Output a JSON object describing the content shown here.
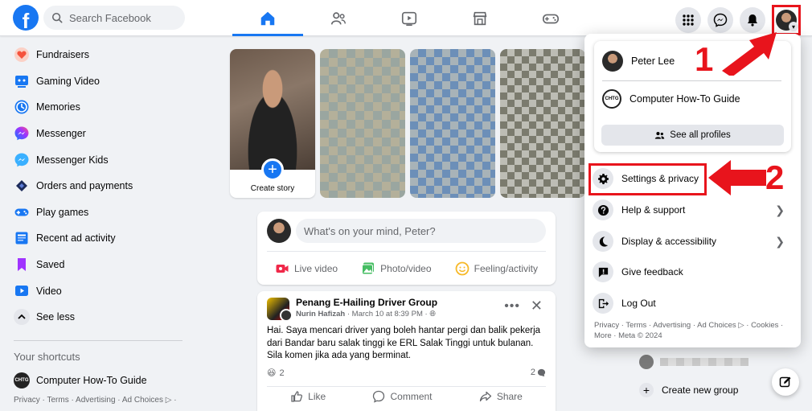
{
  "top_bar": {
    "logo": "f",
    "search_placeholder": "Search Facebook",
    "nav_tabs": [
      "home-icon",
      "friends-icon",
      "video-icon",
      "marketplace-icon",
      "gaming-icon"
    ],
    "right_icons": [
      "menu-grid-icon",
      "messenger-icon",
      "bell-icon",
      "account-avatar"
    ]
  },
  "sidebar": {
    "items": [
      {
        "label": "Fundraisers",
        "icon": "fundraiser-icon",
        "color": "#f5533d"
      },
      {
        "label": "Gaming Video",
        "icon": "gaming-video-icon",
        "color": "#1877f2"
      },
      {
        "label": "Memories",
        "icon": "memories-icon",
        "color": "#1877f2"
      },
      {
        "label": "Messenger",
        "icon": "messenger-icon",
        "color": "#a033ff"
      },
      {
        "label": "Messenger Kids",
        "icon": "messenger-kids-icon",
        "color": "#3ab0ff"
      },
      {
        "label": "Orders and payments",
        "icon": "orders-icon",
        "color": "#1c2b5a"
      },
      {
        "label": "Play games",
        "icon": "play-games-icon",
        "color": "#1877f2"
      },
      {
        "label": "Recent ad activity",
        "icon": "ad-activity-icon",
        "color": "#1877f2"
      },
      {
        "label": "Saved",
        "icon": "saved-icon",
        "color": "#a033ff"
      },
      {
        "label": "Video",
        "icon": "video-icon",
        "color": "#1877f2"
      },
      {
        "label": "See less",
        "icon": "chevron-up-icon",
        "color": "#e4e6eb"
      }
    ],
    "shortcuts_title": "Your shortcuts",
    "shortcut": {
      "label": "Computer How-To Guide",
      "logo": "CHTG"
    },
    "footer": "Privacy · Terms · Advertising · Ad Choices ▷ ·"
  },
  "stories": {
    "create_label": "Create story",
    "plus": "+"
  },
  "composer": {
    "placeholder": "What's on your mind, Peter?",
    "actions": [
      "Live video",
      "Photo/video",
      "Feeling/activity"
    ]
  },
  "post": {
    "group": "Penang E-Hailing Driver Group",
    "author": "Nurin Hafizah",
    "meta": " · March 10 at 8:39 PM · ",
    "text": "Hai. Saya mencari driver yang boleh hantar pergi dan balik pekerja dari Bandar baru salak tinggi ke ERL Salak Tinggi untuk bulanan. Sila komen jika ada yang berminat.",
    "reactions": "2",
    "comments": "2",
    "actions": [
      "Like",
      "Comment",
      "Share"
    ]
  },
  "right_panel": {
    "create_group": "Create new group"
  },
  "dropdown": {
    "profiles": [
      {
        "name": "Peter Lee"
      },
      {
        "name": "Computer How-To Guide",
        "logo": "CHTG"
      }
    ],
    "see_all": "See all profiles",
    "menu": [
      {
        "label": "Settings & privacy",
        "icon": "gear-icon",
        "chevron": false
      },
      {
        "label": "Help & support",
        "icon": "help-icon",
        "chevron": true
      },
      {
        "label": "Display & accessibility",
        "icon": "moon-icon",
        "chevron": true
      },
      {
        "label": "Give feedback",
        "icon": "feedback-icon",
        "chevron": false
      },
      {
        "label": "Log Out",
        "icon": "logout-icon",
        "chevron": false
      }
    ],
    "footer": "Privacy · Terms · Advertising · Ad Choices ▷ · Cookies · More · Meta © 2024"
  },
  "annotations": {
    "step1": "1",
    "step2": "2",
    "color": "#e8141c"
  }
}
